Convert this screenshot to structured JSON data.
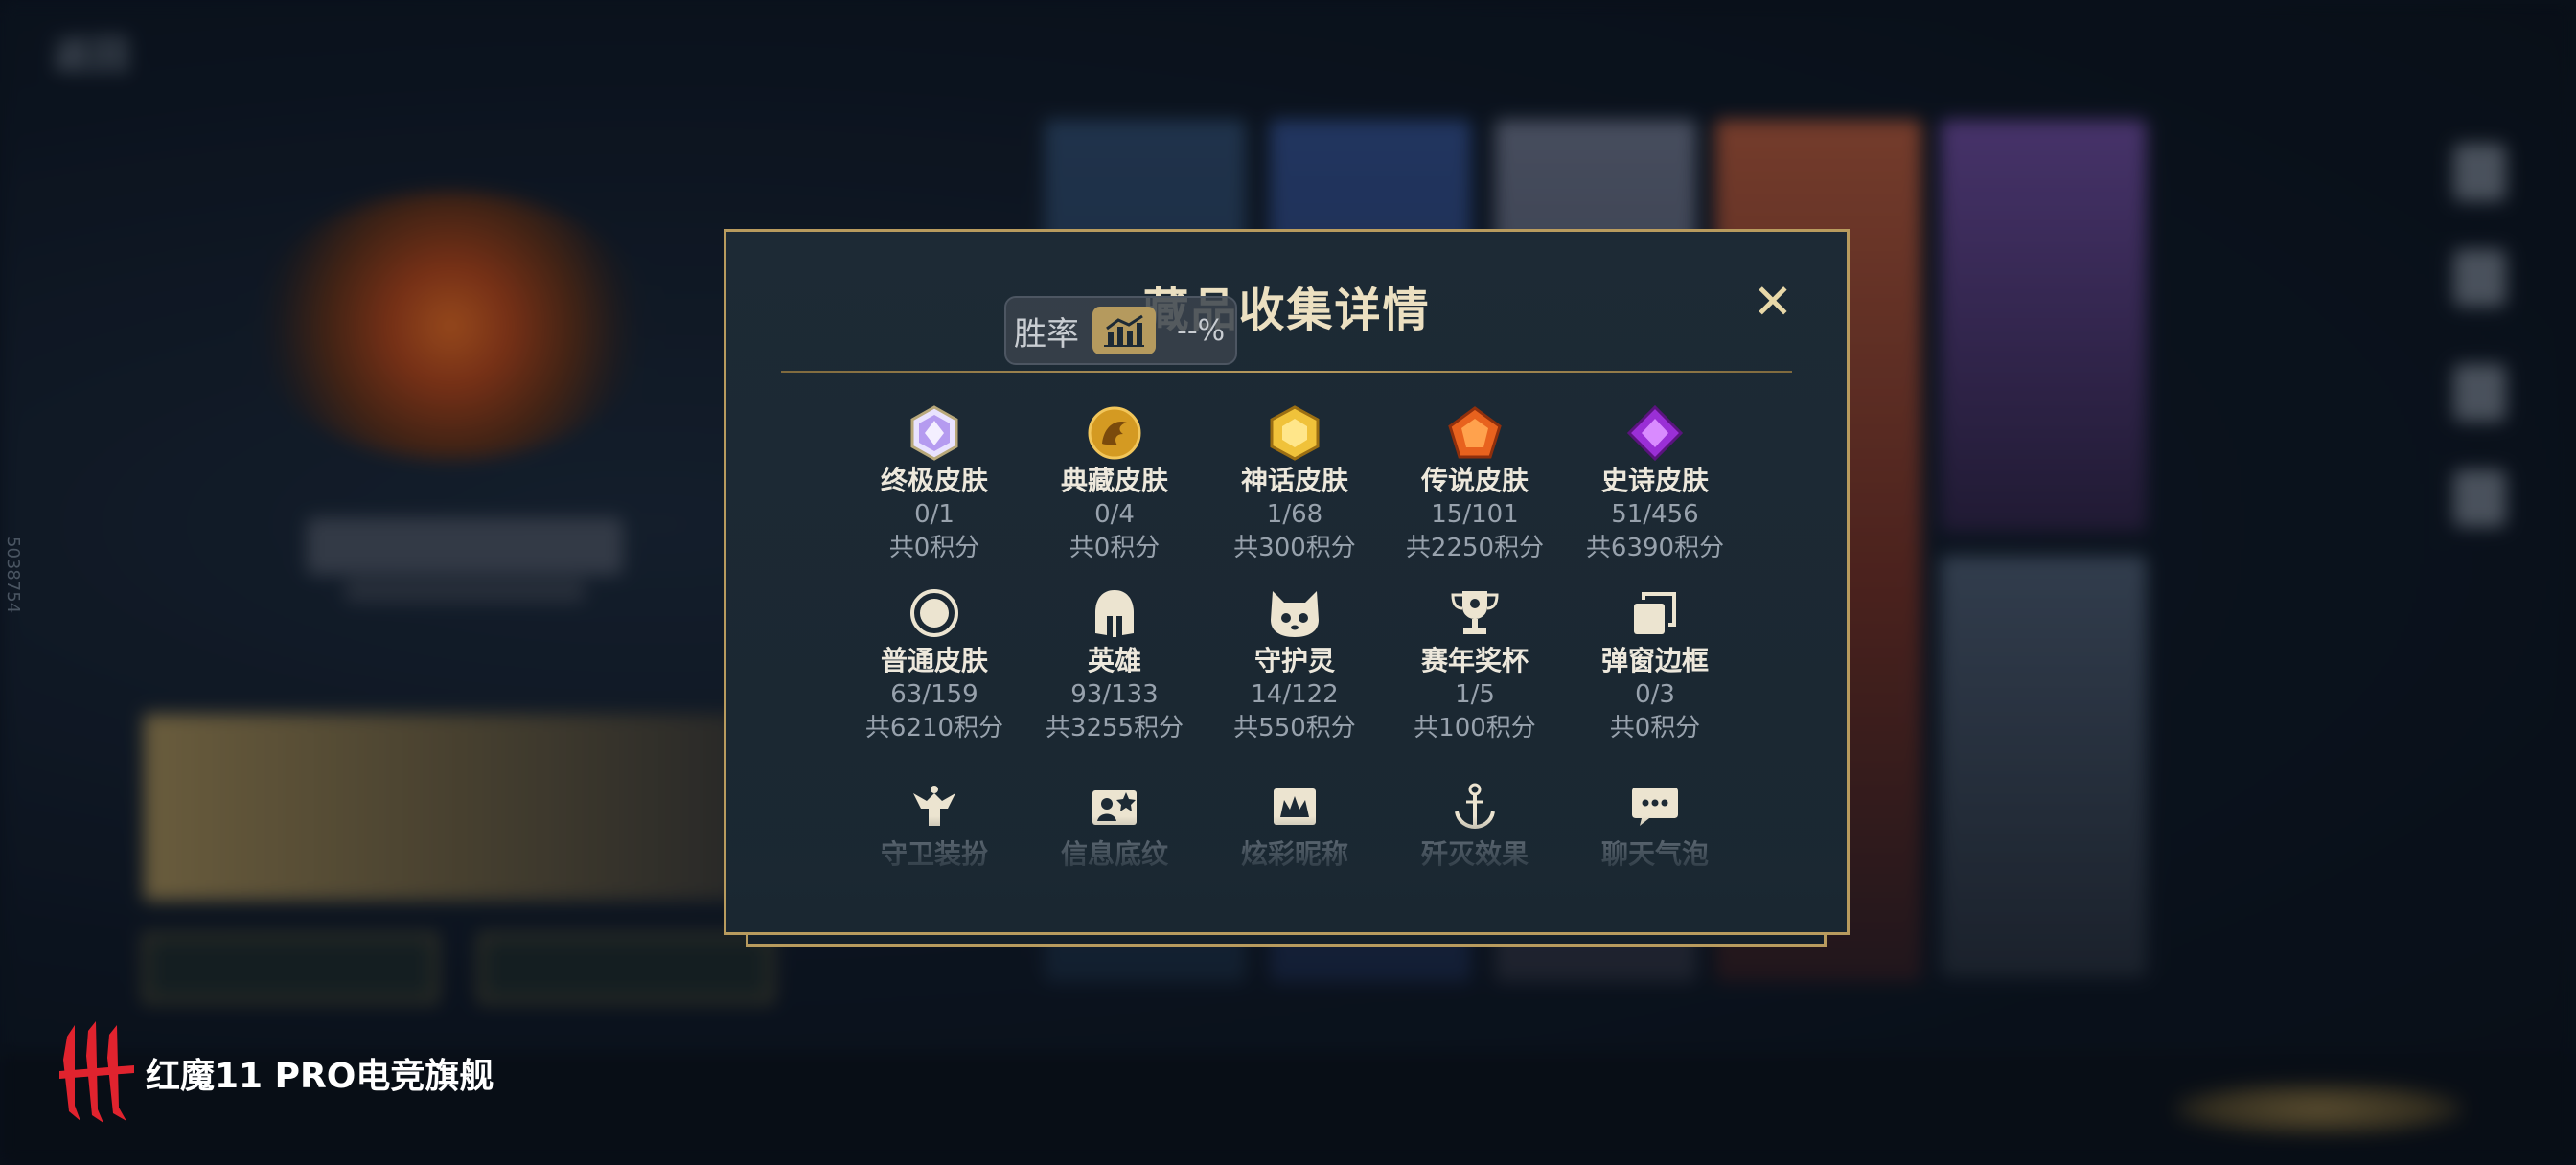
{
  "background": {
    "back_label": "返回"
  },
  "modal": {
    "title": "藏品收集详情",
    "close_glyph": "✕",
    "winrate": {
      "label": "胜率",
      "value": "--%"
    },
    "rows": [
      [
        {
          "name": "终极皮肤",
          "count": "0/1",
          "points": "共0积分",
          "icon": "ultimate-gem-icon"
        },
        {
          "name": "典藏皮肤",
          "count": "0/4",
          "points": "共0积分",
          "icon": "dragon-medal-icon"
        },
        {
          "name": "神话皮肤",
          "count": "1/68",
          "points": "共300积分",
          "icon": "gold-gem-icon"
        },
        {
          "name": "传说皮肤",
          "count": "15/101",
          "points": "共2250积分",
          "icon": "orange-gem-icon"
        },
        {
          "name": "史诗皮肤",
          "count": "51/456",
          "points": "共6390积分",
          "icon": "purple-gem-icon"
        }
      ],
      [
        {
          "name": "普通皮肤",
          "count": "63/159",
          "points": "共6210积分",
          "icon": "ring-icon"
        },
        {
          "name": "英雄",
          "count": "93/133",
          "points": "共3255积分",
          "icon": "helmet-icon"
        },
        {
          "name": "守护灵",
          "count": "14/122",
          "points": "共550积分",
          "icon": "guardian-spirit-icon"
        },
        {
          "name": "赛年奖杯",
          "count": "1/5",
          "points": "共100积分",
          "icon": "trophy-icon"
        },
        {
          "name": "弹窗边框",
          "count": "0/3",
          "points": "共0积分",
          "icon": "frame-icon"
        }
      ],
      [
        {
          "name": "守卫装扮",
          "icon": "guard-costume-icon"
        },
        {
          "name": "信息底纹",
          "icon": "info-background-icon"
        },
        {
          "name": "炫彩昵称",
          "icon": "colorful-nickname-icon"
        },
        {
          "name": "歼灭效果",
          "icon": "annihilation-effect-icon"
        },
        {
          "name": "聊天气泡",
          "icon": "chat-bubble-icon"
        }
      ]
    ]
  },
  "watermark": {
    "text": "红魔11 PRO电竞旗舰"
  },
  "side_number": "5038754"
}
